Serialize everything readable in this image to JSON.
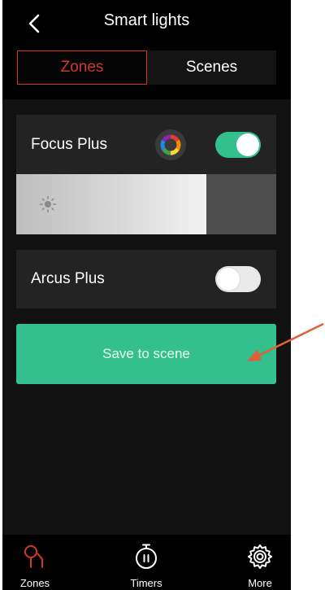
{
  "header": {
    "title": "Smart lights"
  },
  "segments": {
    "zones_label": "Zones",
    "scenes_label": "Scenes",
    "active": "Zones"
  },
  "lights": [
    {
      "name": "Focus Plus",
      "on": true,
      "brightness_percent": 73
    },
    {
      "name": "Arcus Plus",
      "on": false
    }
  ],
  "actions": {
    "save_label": "Save to scene"
  },
  "tabbar": {
    "items": [
      {
        "label": "Zones",
        "icon": "zones-icon",
        "active": true
      },
      {
        "label": "Timers",
        "icon": "timer-icon",
        "active": false
      },
      {
        "label": "More",
        "icon": "gear-icon",
        "active": false
      }
    ]
  },
  "colors": {
    "accent_red": "#d0382b",
    "accent_green": "#34c08e",
    "background": "#111111",
    "card": "#232323",
    "annotation_arrow": "#e0603a"
  }
}
